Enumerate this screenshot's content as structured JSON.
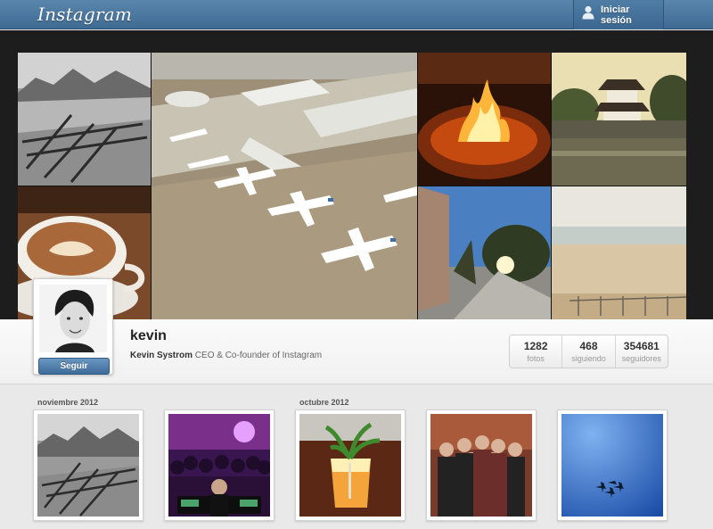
{
  "header": {
    "logo_text": "Instagram",
    "login_label": "Iniciar sesión",
    "brand_color": "#4b78a2"
  },
  "profile": {
    "username": "kevin",
    "full_name": "Kevin Systrom",
    "bio": " CEO & Co-founder of Instagram",
    "follow_label": "Seguir",
    "stats": [
      {
        "value": "1282",
        "label": "fotos"
      },
      {
        "value": "468",
        "label": "siguiendo"
      },
      {
        "value": "354681",
        "label": "seguidores"
      }
    ]
  },
  "grid": {
    "months": [
      "noviembre 2012",
      "octubre 2012"
    ]
  },
  "mosaic_icons": [
    "mountain-photo",
    "latte-photo",
    "airport-photo",
    "fire-photo",
    "castle-photo",
    "street-photo",
    "beach-photo"
  ],
  "thumb_icons": [
    "mountain-photo",
    "dj-party-photo",
    "cocktail-photo",
    "band-group-photo",
    "sky-jets-photo"
  ]
}
